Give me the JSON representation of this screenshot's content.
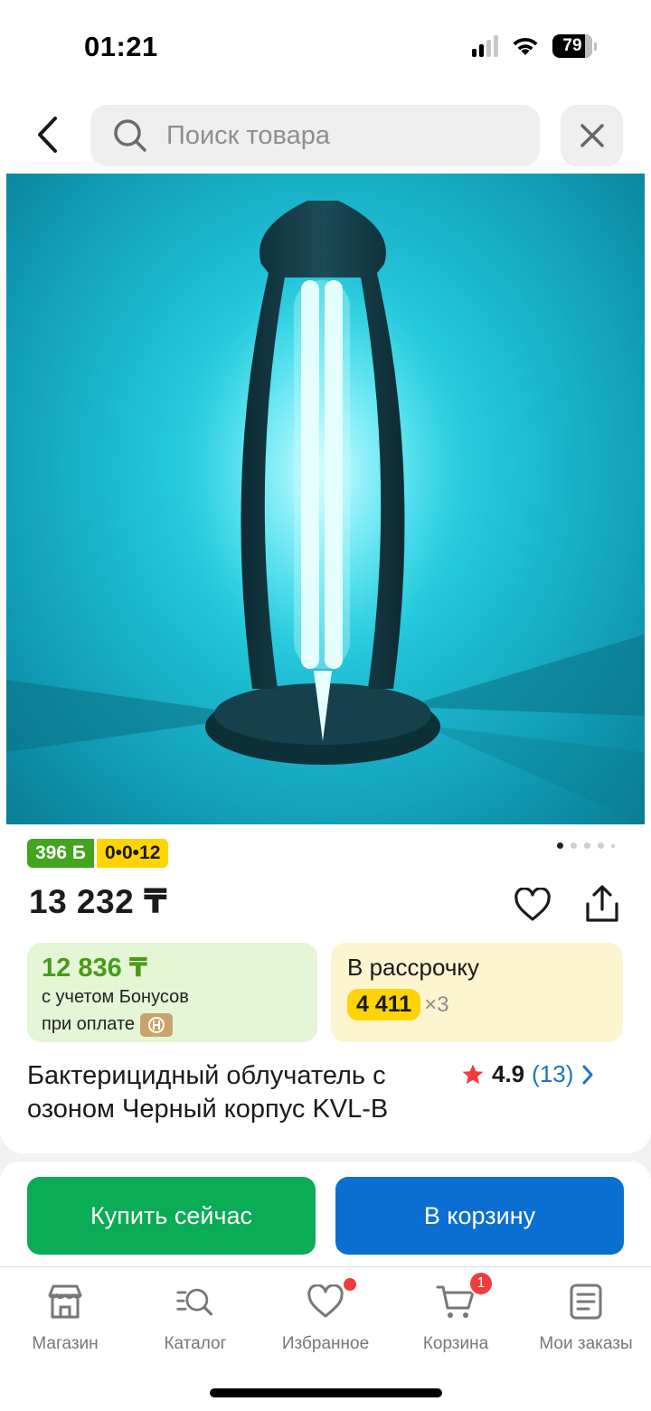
{
  "status_bar": {
    "time": "01:21",
    "battery": "79"
  },
  "header": {
    "search_placeholder": "Поиск товара"
  },
  "product": {
    "image_alt": "Бактерицидный облучатель",
    "bonus_badge": "396 Б",
    "installment_badge": "0•0•12",
    "price": "13 232 ₸",
    "bonus_box": {
      "price": "12 836 ₸",
      "line1": "с учетом Бонусов",
      "line2": "при оплате"
    },
    "installment_box": {
      "title": "В рассрочку",
      "amount": "4 411",
      "multiplier": "×3"
    },
    "title": "Бактерицидный облучатель с озоном Черный корпус KVL-B",
    "rating": {
      "value": "4.9",
      "count": "(13)"
    },
    "image_dots": {
      "count": 5,
      "active": 0
    }
  },
  "actions": {
    "buy_now": "Купить сейчас",
    "add_to_cart": "В корзину"
  },
  "tab_bar": {
    "items": [
      {
        "label": "Магазин",
        "icon": "shop-icon"
      },
      {
        "label": "Каталог",
        "icon": "catalog-search-icon"
      },
      {
        "label": "Избранное",
        "icon": "heart-icon"
      },
      {
        "label": "Корзина",
        "icon": "cart-icon"
      },
      {
        "label": "Мои заказы",
        "icon": "orders-icon"
      }
    ],
    "cart_count": "1"
  },
  "colors": {
    "buy_now": "#0aac55",
    "add_to_cart": "#0a6fd1",
    "bonus_green": "#43a41e",
    "installment_yellow": "#ffd400",
    "badge_red": "#f23b3b"
  }
}
